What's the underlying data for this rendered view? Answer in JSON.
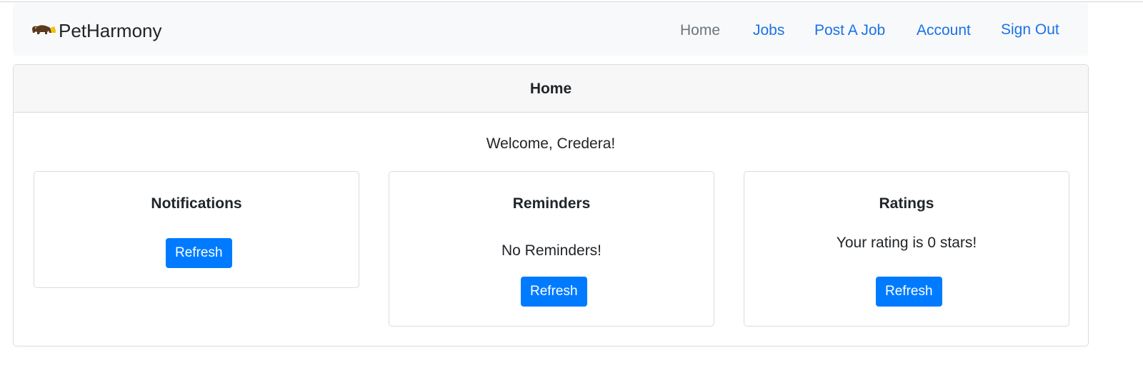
{
  "navbar": {
    "brand": "PetHarmony",
    "links": [
      {
        "label": "Home",
        "active": true
      },
      {
        "label": "Jobs",
        "active": false
      },
      {
        "label": "Post A Job",
        "active": false
      },
      {
        "label": "Account",
        "active": false
      },
      {
        "label": "Sign Out",
        "active": false
      }
    ]
  },
  "page": {
    "header": "Home",
    "welcome": "Welcome, Credera!"
  },
  "panels": {
    "notifications": {
      "title": "Notifications",
      "button": "Refresh"
    },
    "reminders": {
      "title": "Reminders",
      "text": "No Reminders!",
      "button": "Refresh"
    },
    "ratings": {
      "title": "Ratings",
      "text": "Your rating is 0 stars!",
      "button": "Refresh"
    }
  },
  "colors": {
    "primary": "#007bff",
    "link": "#1a73e8",
    "active_link": "#6c757d",
    "navbar_bg": "#f8f9fa",
    "logo_bear": "#5a3a1c",
    "logo_accent": "#f2c200"
  }
}
